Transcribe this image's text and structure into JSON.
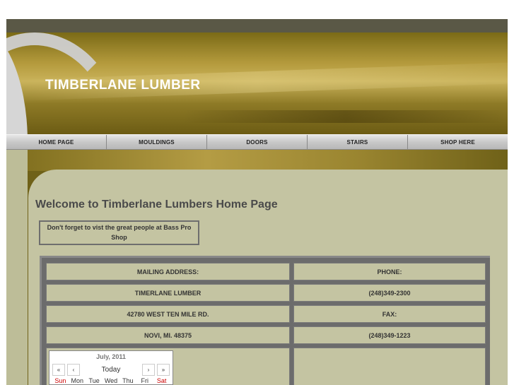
{
  "site": {
    "title": "TIMBERLANE LUMBER"
  },
  "nav": {
    "items": [
      {
        "label": "HOME PAGE"
      },
      {
        "label": "MOULDINGS"
      },
      {
        "label": "DOORS"
      },
      {
        "label": "STAIRS"
      },
      {
        "label": "SHOP HERE"
      }
    ]
  },
  "main": {
    "welcome": "Welcome to Timberlane Lumbers Home Page",
    "promo": "Don't forget to vist the great people at Bass Pro Shop"
  },
  "info": {
    "mailing_label": "MAILING ADDRESS:",
    "company": "TIMERLANE LUMBER",
    "street": "42780 WEST TEN MILE RD.",
    "city": "NOVI,  MI. 48375",
    "phone_label": "PHONE:",
    "phone": "(248)349-2300",
    "fax_label": "FAX:",
    "fax": "(248)349-1223"
  },
  "calendar": {
    "month_label": "July, 2011",
    "prev_year": "«",
    "prev_month": "‹",
    "today": "Today",
    "next_month": "›",
    "next_year": "»",
    "days": [
      "Sun",
      "Mon",
      "Tue",
      "Wed",
      "Thu",
      "Fri",
      "Sat"
    ]
  },
  "colors": {
    "banner_gold": "#b49a3c",
    "content_bg": "#c4c4a2",
    "frame_olive": "#6f6118"
  }
}
